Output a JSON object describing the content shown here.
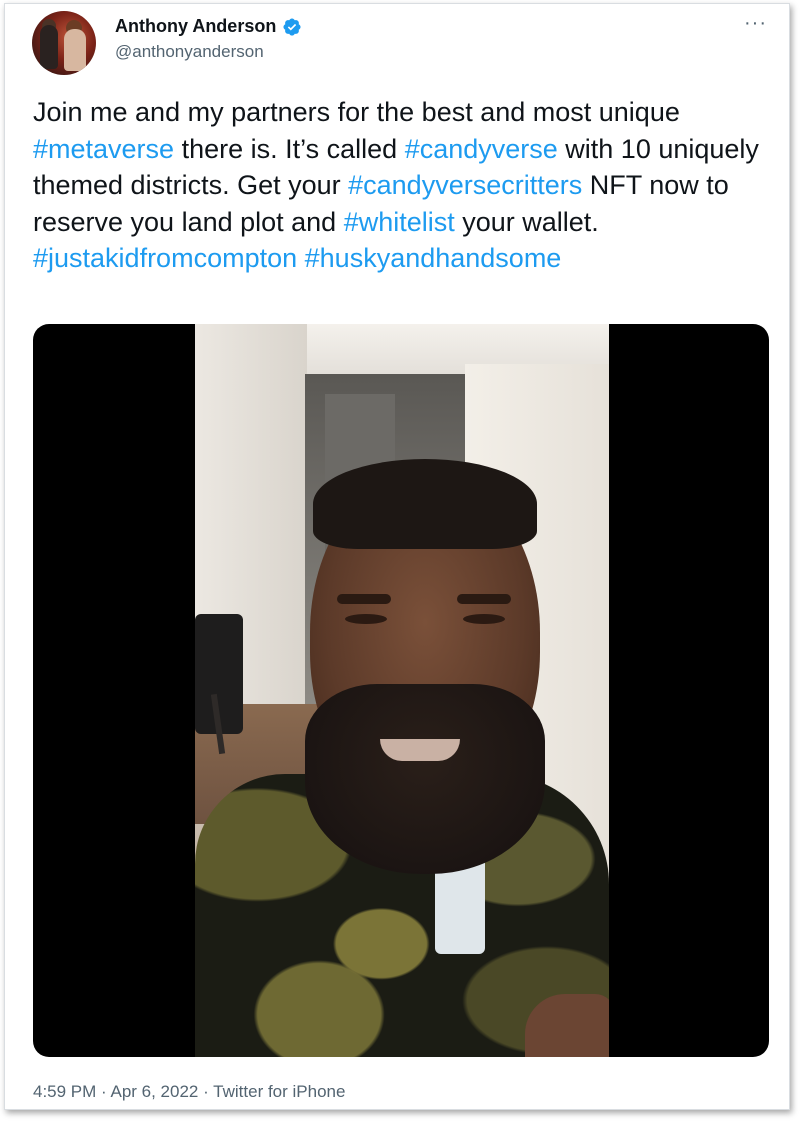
{
  "tweet": {
    "author": {
      "name": "Anthony Anderson",
      "handle": "@anthonyanderson",
      "verified_icon": "verified-badge-icon",
      "avatar": "avatar-photo"
    },
    "more_icon": "more-options-icon",
    "more_label": "···",
    "text": {
      "s1": "Join me and my partners for the best and most unique ",
      "t1": "#metaverse",
      "s2": " there is. It’s called ",
      "t2": "#candyverse",
      "s3": " with 10 uniquely themed districts. Get your ",
      "t3": "#candyversecritters",
      "s4": " NFT now to reserve you land plot and ",
      "t4": "#whitelist",
      "s5": " your wallet. ",
      "t5": "#justakidfromcompton",
      "s6": " ",
      "t6": "#huskyandhandsome"
    },
    "media": "video-thumbnail",
    "meta": "4:59 PM · Apr 6, 2022 · Twitter for iPhone"
  },
  "colors": {
    "link": "#1d9bf0",
    "text": "#0f1419",
    "secondary": "#536471",
    "verified": "#1d9bf0"
  }
}
